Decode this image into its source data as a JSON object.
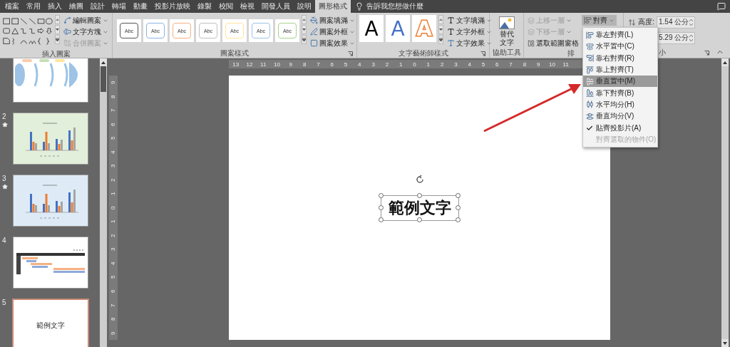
{
  "tabs": [
    {
      "label": "檔案",
      "selected": false
    },
    {
      "label": "常用",
      "selected": false
    },
    {
      "label": "插入",
      "selected": false
    },
    {
      "label": "繪圖",
      "selected": false
    },
    {
      "label": "設計",
      "selected": false
    },
    {
      "label": "轉場",
      "selected": false
    },
    {
      "label": "動畫",
      "selected": false
    },
    {
      "label": "投影片放映",
      "selected": false
    },
    {
      "label": "錄製",
      "selected": false
    },
    {
      "label": "校閱",
      "selected": false
    },
    {
      "label": "檢視",
      "selected": false
    },
    {
      "label": "開發人員",
      "selected": false
    },
    {
      "label": "說明",
      "selected": false
    },
    {
      "label": "圖形格式",
      "selected": true
    }
  ],
  "tell_me": "告訴我您想做什麼",
  "insert_shapes": {
    "buttons": [
      {
        "label": "編輯圖案",
        "disabled": false
      },
      {
        "label": "文字方塊",
        "disabled": false
      },
      {
        "label": "合併圖案",
        "disabled": true
      }
    ],
    "group_label": "插入圖案"
  },
  "shape_styles": {
    "tiles": [
      {
        "label": "Abc",
        "color": "#555555"
      },
      {
        "label": "Abc",
        "color": "#8fb4e3"
      },
      {
        "label": "Abc",
        "color": "#f4b183"
      },
      {
        "label": "Abc",
        "color": "#bfbfbf"
      },
      {
        "label": "Abc",
        "color": "#ffe699"
      },
      {
        "label": "Abc",
        "color": "#9dc3e6"
      },
      {
        "label": "Abc",
        "color": "#a9d18e"
      }
    ],
    "buttons": [
      {
        "label": "圖案填滿"
      },
      {
        "label": "圖案外框"
      },
      {
        "label": "圖案效果"
      }
    ],
    "group_label": "圖案樣式"
  },
  "wordart_styles": {
    "tiles": [
      {
        "label": "A",
        "kind": "plain"
      },
      {
        "label": "A",
        "kind": "accent"
      },
      {
        "label": "A",
        "kind": "outline"
      }
    ],
    "buttons": [
      {
        "label": "文字填滿"
      },
      {
        "label": "文字外框"
      },
      {
        "label": "文字效果"
      }
    ],
    "group_label": "文字藝術師樣式"
  },
  "accessibility": {
    "button": "替代文字",
    "group_label": "協助工具"
  },
  "arrange": {
    "buttons": [
      {
        "label": "上移一層",
        "disabled": true
      },
      {
        "label": "下移一層",
        "disabled": true
      },
      {
        "label": "選取範圍窗格",
        "disabled": false
      }
    ],
    "align_button": {
      "label": "對齊",
      "open": true
    },
    "group_label": "排"
  },
  "size": {
    "fields": [
      {
        "label": "高度:",
        "value": "1.54 公分"
      },
      {
        "value": "5.29 公分"
      }
    ],
    "group_label": "小"
  },
  "align_menu": {
    "items": [
      {
        "label": "靠左對齊(L)",
        "selected": false,
        "checked": false,
        "disabled": false
      },
      {
        "label": "水平置中(C)",
        "selected": false,
        "checked": false,
        "disabled": false
      },
      {
        "label": "靠右對齊(R)",
        "selected": false,
        "checked": false,
        "disabled": false
      },
      {
        "label": "靠上對齊(T)",
        "selected": false,
        "checked": false,
        "disabled": false
      },
      {
        "label": "垂直置中(M)",
        "selected": true,
        "checked": false,
        "disabled": false
      },
      {
        "label": "靠下對齊(B)",
        "selected": false,
        "checked": false,
        "disabled": false
      },
      {
        "label": "水平均分(H)",
        "selected": false,
        "checked": false,
        "disabled": false
      },
      {
        "label": "垂直均分(V)",
        "selected": false,
        "checked": false,
        "disabled": false
      },
      {
        "label": "貼齊投影片(A)",
        "selected": false,
        "checked": true,
        "disabled": false
      },
      {
        "label": "對齊選取的物件(O)",
        "selected": false,
        "checked": false,
        "disabled": true
      }
    ]
  },
  "slides": [
    {
      "kind": "fishbone",
      "selected": false,
      "animated": false
    },
    {
      "number": "2",
      "kind": "bar_chart",
      "color": "#e2efda",
      "selected": false,
      "animated": true
    },
    {
      "number": "3",
      "kind": "bar_chart",
      "color": "#deebf7",
      "selected": false,
      "animated": true
    },
    {
      "number": "4",
      "kind": "gantt",
      "selected": false,
      "animated": false
    },
    {
      "number": "5",
      "kind": "text",
      "text": "範例文字",
      "selected": true,
      "animated": false
    }
  ],
  "rulers": {
    "horizontal": [
      "13",
      "12",
      "11",
      "10",
      "9",
      "8",
      "7",
      "6",
      "5",
      "4",
      "3",
      "2",
      "1",
      "0",
      "1",
      "2",
      "3",
      "4",
      "5",
      "6",
      "7",
      "8",
      "9",
      "10",
      "11"
    ],
    "vertical": [
      "9",
      "8",
      "7",
      "6",
      "5",
      "4",
      "3",
      "2",
      "1",
      "0",
      "1",
      "2",
      "3",
      "4",
      "5",
      "6",
      "7",
      "8",
      "9"
    ]
  },
  "slide": {
    "text": "範例文字"
  }
}
